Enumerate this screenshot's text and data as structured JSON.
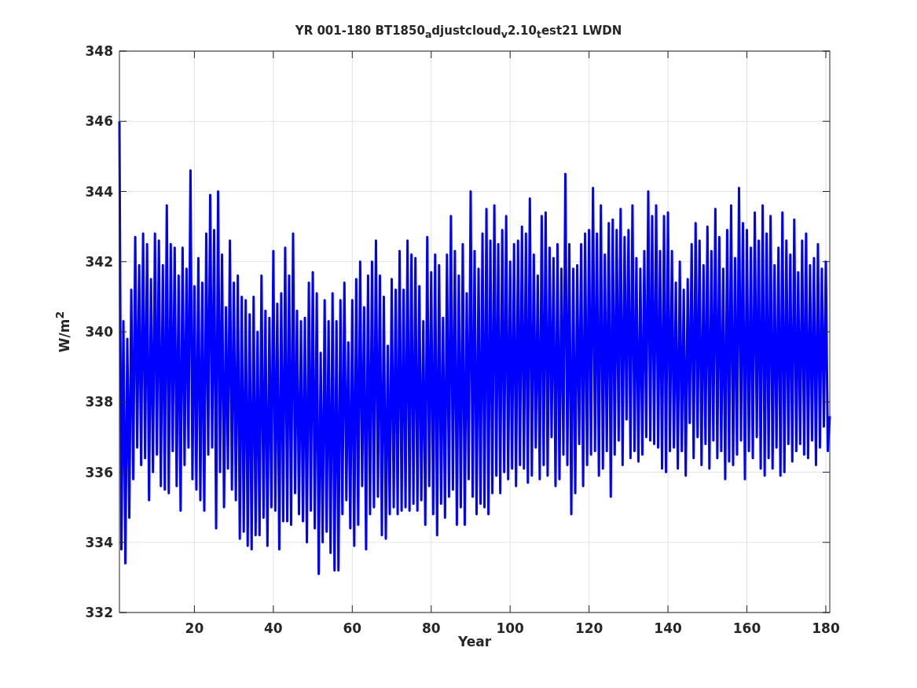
{
  "plot": {
    "chart_data": {
      "type": "line",
      "title": "YR 001-180 BT1850$_{a}$djustcloud$_{v}$2.10$_{t}$est21 LWDN",
      "xlabel": "Year",
      "ylabel": "W/m$^{2}$",
      "grid": true,
      "xlim": [
        1,
        181
      ],
      "x": [
        1,
        1.5,
        2,
        2.5,
        3,
        3.5,
        4,
        4.5,
        5,
        5.5,
        6,
        6.5,
        7,
        7.5,
        8,
        8.5,
        9,
        9.5,
        10,
        10.5,
        11,
        11.5,
        12,
        12.5,
        13,
        13.5,
        14,
        14.5,
        15,
        15.5,
        16,
        16.5,
        17,
        17.5,
        18,
        18.5,
        19,
        19.5,
        20,
        20.5,
        21,
        21.5,
        22,
        22.5,
        23,
        23.5,
        24,
        24.5,
        25,
        25.5,
        26,
        26.5,
        27,
        27.5,
        28,
        28.5,
        29,
        29.5,
        30,
        30.5,
        31,
        31.5,
        32,
        32.5,
        33,
        33.5,
        34,
        34.5,
        35,
        35.5,
        36,
        36.5,
        37,
        37.5,
        38,
        38.5,
        39,
        39.5,
        40,
        40.5,
        41,
        41.5,
        42,
        42.5,
        43,
        43.5,
        44,
        44.5,
        45,
        45.5,
        46,
        46.5,
        47,
        47.5,
        48,
        48.5,
        49,
        49.5,
        50,
        50.5,
        51,
        51.5,
        52,
        52.5,
        53,
        53.5,
        54,
        54.5,
        55,
        55.5,
        56,
        56.5,
        57,
        57.5,
        58,
        58.5,
        59,
        59.5,
        60,
        60.5,
        61,
        61.5,
        62,
        62.5,
        63,
        63.5,
        64,
        64.5,
        65,
        65.5,
        66,
        66.5,
        67,
        67.5,
        68,
        68.5,
        69,
        69.5,
        70,
        70.5,
        71,
        71.5,
        72,
        72.5,
        73,
        73.5,
        74,
        74.5,
        75,
        75.5,
        76,
        76.5,
        77,
        77.5,
        78,
        78.5,
        79,
        79.5,
        80,
        80.5,
        81,
        81.5,
        82,
        82.5,
        83,
        83.5,
        84,
        84.5,
        85,
        85.5,
        86,
        86.5,
        87,
        87.5,
        88,
        88.5,
        89,
        89.5,
        90,
        90.5,
        91,
        91.5,
        92,
        92.5,
        93,
        93.5,
        94,
        94.5,
        95,
        95.5,
        96,
        96.5,
        97,
        97.5,
        98,
        98.5,
        99,
        99.5,
        100,
        100.5,
        101,
        101.5,
        102,
        102.5,
        103,
        103.5,
        104,
        104.5,
        105,
        105.5,
        106,
        106.5,
        107,
        107.5,
        108,
        108.5,
        109,
        109.5,
        110,
        110.5,
        111,
        111.5,
        112,
        112.5,
        113,
        113.5,
        114,
        114.5,
        115,
        115.5,
        116,
        116.5,
        117,
        117.5,
        118,
        118.5,
        119,
        119.5,
        120,
        120.5,
        121,
        121.5,
        122,
        122.5,
        123,
        123.5,
        124,
        124.5,
        125,
        125.5,
        126,
        126.5,
        127,
        127.5,
        128,
        128.5,
        129,
        129.5,
        130,
        130.5,
        131,
        131.5,
        132,
        132.5,
        133,
        133.5,
        134,
        134.5,
        135,
        135.5,
        136,
        136.5,
        137,
        137.5,
        138,
        138.5,
        139,
        139.5,
        140,
        140.5,
        141,
        141.5,
        142,
        142.5,
        143,
        143.5,
        144,
        144.5,
        145,
        145.5,
        146,
        146.5,
        147,
        147.5,
        148,
        148.5,
        149,
        149.5,
        150,
        150.5,
        151,
        151.5,
        152,
        152.5,
        153,
        153.5,
        154,
        154.5,
        155,
        155.5,
        156,
        156.5,
        157,
        157.5,
        158,
        158.5,
        159,
        159.5,
        160,
        160.5,
        161,
        161.5,
        162,
        162.5,
        163,
        163.5,
        164,
        164.5,
        165,
        165.5,
        166,
        166.5,
        167,
        167.5,
        168,
        168.5,
        169,
        169.5,
        170,
        170.5,
        171,
        171.5,
        172,
        172.5,
        173,
        173.5,
        174,
        174.5,
        175,
        175.5,
        176,
        176.5,
        177,
        177.5,
        178,
        178.5,
        179,
        179.5,
        180,
        180.5,
        181
      ],
      "ylim": [
        332,
        348
      ],
      "xticks": [
        20,
        40,
        60,
        80,
        100,
        120,
        140,
        160,
        180
      ],
      "yticks": [
        332,
        334,
        336,
        338,
        340,
        342,
        344,
        346,
        348
      ],
      "series": [
        {
          "color": "#0000ff",
          "values": [
            346,
            333.8,
            340.3,
            333.4,
            339.8,
            334.7,
            341.2,
            335.8,
            342.7,
            336.7,
            341.9,
            336.2,
            342.8,
            336.4,
            342.5,
            335.2,
            341.5,
            336,
            342.8,
            336.5,
            342.6,
            335.6,
            341.9,
            335.5,
            343.6,
            335.4,
            342.5,
            336.6,
            342.4,
            335.6,
            341.6,
            334.9,
            342.4,
            336.2,
            341.8,
            336.7,
            344.6,
            335.8,
            341.3,
            335.5,
            342.1,
            335.2,
            341.4,
            334.9,
            342.8,
            336.5,
            343.9,
            336.7,
            342.9,
            334.4,
            344,
            336,
            342.2,
            335,
            340.7,
            336.1,
            342.6,
            335.5,
            341.4,
            335.2,
            341.6,
            334.1,
            341,
            334.3,
            340.9,
            333.9,
            340.5,
            333.8,
            341,
            334.2,
            340,
            334.2,
            341.6,
            334.7,
            340.6,
            333.9,
            340.4,
            335,
            342.3,
            334.9,
            340.8,
            333.8,
            341.1,
            334.6,
            342.4,
            334.6,
            341.6,
            334.5,
            342.8,
            335.4,
            340.6,
            334.8,
            340.3,
            334.6,
            340.4,
            334,
            341.4,
            334.9,
            341.7,
            334.4,
            341.1,
            333.1,
            339.4,
            334,
            340.9,
            334.3,
            340.3,
            333.7,
            341.1,
            333.2,
            340.3,
            333.2,
            340.9,
            334.8,
            341.4,
            335.2,
            339.7,
            334.4,
            340.9,
            333.9,
            341.5,
            334.5,
            342,
            335.6,
            340.7,
            333.8,
            341.6,
            334.8,
            342,
            335,
            342.6,
            335.3,
            341.6,
            334.2,
            341,
            334.1,
            339.6,
            334.8,
            341.5,
            335,
            341.2,
            334.8,
            342.3,
            334.9,
            341.2,
            335,
            342.6,
            334.9,
            342.2,
            335.1,
            342.1,
            334.9,
            341.3,
            335.2,
            340.3,
            334.5,
            342.7,
            335.6,
            341.7,
            334.8,
            342.2,
            334.2,
            341.9,
            335.1,
            340.4,
            334.7,
            342.2,
            335.3,
            343.3,
            335.5,
            342.3,
            334.5,
            341.6,
            335,
            342.5,
            334.5,
            341.1,
            335.8,
            344,
            335.3,
            342.3,
            334.8,
            341.8,
            335.1,
            342.8,
            335,
            343.5,
            334.8,
            342.6,
            335.4,
            343.6,
            335.9,
            342.5,
            335.4,
            342.9,
            336,
            343.3,
            335.8,
            342,
            336.1,
            342.5,
            335.6,
            342.6,
            336.2,
            343,
            336.1,
            342.8,
            335.7,
            343.8,
            335.9,
            342.2,
            336.7,
            341.6,
            335.8,
            343.3,
            336.2,
            343.4,
            335.9,
            342.4,
            337,
            342.1,
            335.6,
            342.5,
            335.8,
            341.8,
            336.5,
            344.5,
            336.2,
            342.5,
            334.8,
            341.8,
            335.4,
            341.9,
            336.8,
            342.5,
            335.6,
            342.8,
            336.2,
            342.9,
            336.5,
            344.1,
            336.6,
            342.8,
            335.9,
            343.6,
            336.1,
            342.2,
            336.6,
            343.1,
            335.3,
            343.2,
            336.5,
            342.9,
            336.9,
            343.5,
            336.2,
            342.7,
            337.5,
            342.9,
            336.4,
            343.6,
            336.6,
            342.1,
            336.3,
            341.8,
            336.5,
            342.3,
            337,
            344,
            336.9,
            343.3,
            336.8,
            343.6,
            336.7,
            342.3,
            336.1,
            343.3,
            336,
            343.4,
            336.6,
            342.3,
            336.7,
            341.4,
            336.1,
            342,
            336.6,
            341.2,
            335.9,
            341.5,
            337.4,
            342.5,
            336.4,
            343.1,
            337,
            342.6,
            336.2,
            341.9,
            336.8,
            343,
            336.1,
            342.3,
            336.9,
            343.5,
            336.4,
            342.7,
            336.6,
            341.8,
            335.8,
            342.9,
            336.3,
            343.6,
            336.2,
            342.1,
            336.5,
            344.1,
            336.9,
            343.1,
            335.8,
            342.9,
            336.6,
            342.4,
            336.4,
            343.4,
            337,
            342.6,
            336.1,
            343.6,
            335.9,
            342.8,
            336.4,
            343.3,
            336.1,
            341.9,
            336.7,
            342.4,
            335.9,
            343.4,
            336,
            342.6,
            336.8,
            342.2,
            336.3,
            343.2,
            336.6,
            341.7,
            336.8,
            342.6,
            336.5,
            342.8,
            336.4,
            341.9,
            336.9,
            342.1,
            336.2,
            342.5,
            336.7,
            341.8,
            337.3,
            342,
            336.6,
            337.6
          ]
        }
      ]
    }
  }
}
